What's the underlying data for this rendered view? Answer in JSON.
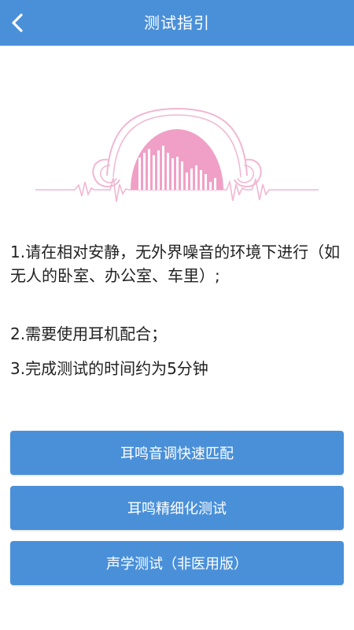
{
  "header": {
    "title": "测试指引",
    "back_icon": "chevron-left-icon"
  },
  "illustration": {
    "name": "headphones-soundwave-illustration",
    "colors": {
      "outline": "#f2b6d2",
      "fill": "#f0a0c6",
      "bars": "#ffffff"
    }
  },
  "instructions": [
    "1.请在相对安静，无外界噪音的环境下进行（如无人的卧室、办公室、车里）;",
    "2.需要使用耳机配合；",
    "3.完成测试的时间约为5分钟"
  ],
  "buttons": [
    "耳鸣音调快速匹配",
    "耳鸣精细化测试",
    "声学测试（非医用版）"
  ],
  "colors": {
    "primary": "#4a90d9",
    "text": "#222222",
    "background": "#ffffff"
  }
}
